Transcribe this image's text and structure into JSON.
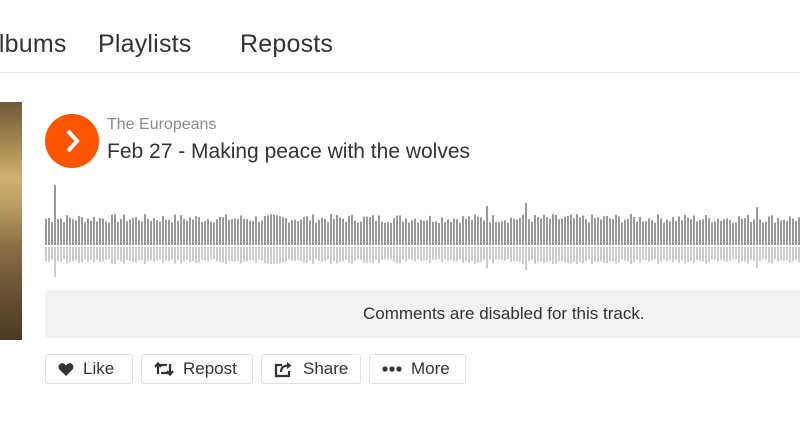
{
  "tabs": {
    "albums": "Albums",
    "playlists": "Playlists",
    "reposts": "Reposts"
  },
  "track": {
    "artist": "The Europeans",
    "title": "Feb 27 - Making peace with the wolves"
  },
  "comments": {
    "disabled_text": "Comments are disabled for this track."
  },
  "actions": {
    "like": "Like",
    "repost": "Repost",
    "share": "Share",
    "more": "More"
  },
  "icons": {
    "play": "play-icon",
    "like": "heart-icon",
    "repost": "repost-icon",
    "share": "share-icon",
    "more": "more-dots-icon"
  },
  "colors": {
    "accent": "#ff5500",
    "waveform": "#999999",
    "waveform_reflection": "#cccccc",
    "comments_bg": "#f2f2f2"
  }
}
